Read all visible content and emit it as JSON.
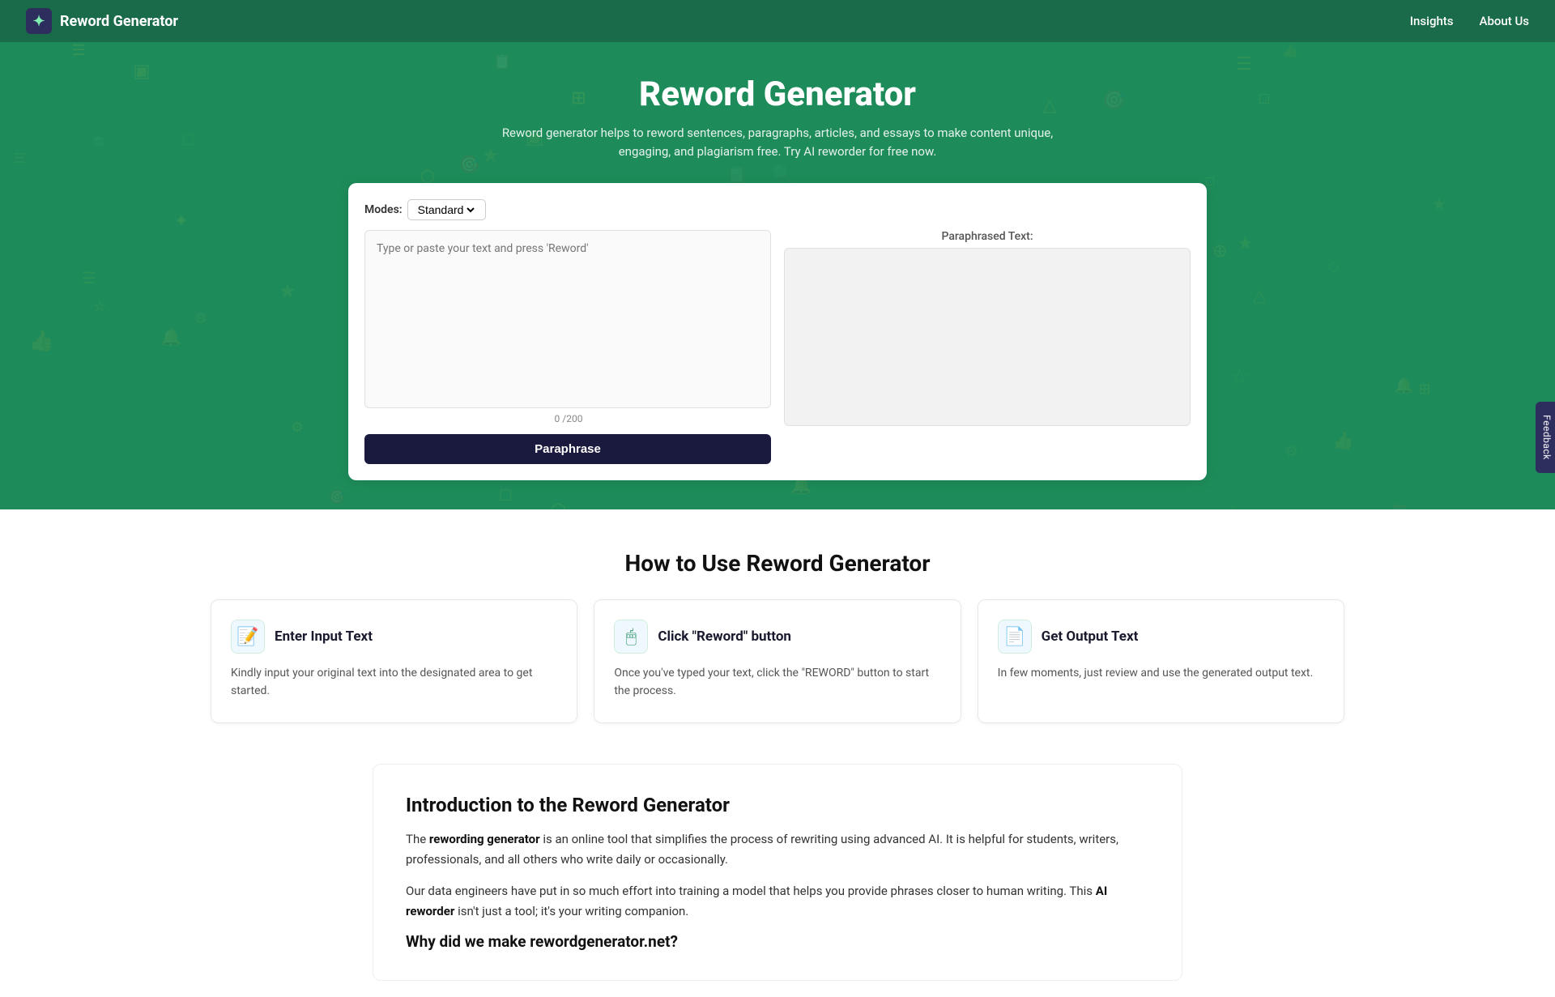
{
  "nav": {
    "brand": "Reword Generator",
    "logo_icon": "✦",
    "links": [
      {
        "label": "Insights",
        "href": "#"
      },
      {
        "label": "About Us",
        "href": "#"
      }
    ]
  },
  "hero": {
    "title": "Reword Generator",
    "subtitle": "Reword generator helps to reword sentences, paragraphs, articles, and essays to make content unique, engaging, and plagiarism free. Try AI reworder for free now.",
    "bg_icons": [
      "☰",
      "⏳",
      "🔍",
      "□",
      "◎",
      "☆",
      "⏳",
      "🔍",
      "⚙",
      "★",
      "⏳",
      "◎",
      "☰",
      "⏳",
      "▣",
      "□",
      "◎",
      "☆",
      "⏳",
      "🔍",
      "⚙",
      "★",
      "⏳",
      "◎",
      "☰",
      "👍",
      "📋",
      "🐦",
      "⏳",
      "☆",
      "★",
      "🔔",
      "🎯",
      "▣",
      "🔍",
      "◎",
      "☰",
      "⏳",
      "☆",
      "⚙",
      "★",
      "▣",
      "□",
      "◎",
      "👍",
      "📋",
      "🐦",
      "⏳",
      "☆",
      "★",
      "🔔",
      "🎯",
      "☰",
      "⏳",
      "▣",
      "🔍",
      "◎",
      "□",
      "◎",
      "☆",
      "⏳",
      "🔍",
      "⚙",
      "★",
      "⏳",
      "◎",
      "☰",
      "⏳",
      "▣",
      "□",
      "◎",
      "☆",
      "⏳",
      "🔍",
      "⚙",
      "★",
      "⏳",
      "◎",
      "☰"
    ]
  },
  "tool": {
    "modes_label": "Modes:",
    "mode_default": "Standard",
    "input_placeholder": "Type or paste your text and press 'Reword'",
    "paraphrased_label": "Paraphrased Text:",
    "char_count": "0",
    "char_max": "200",
    "paraphrase_btn": "Paraphrase"
  },
  "how_to": {
    "title": "How to Use Reword Generator",
    "steps": [
      {
        "icon": "📝",
        "title": "Enter Input Text",
        "desc": "Kindly input your original text into the designated area to get started."
      },
      {
        "icon": "🖱",
        "title": "Click \"Reword\" button",
        "desc": "Once you've typed your text, click the \"REWORD\" button to start the process."
      },
      {
        "icon": "📄",
        "title": "Get Output Text",
        "desc": "In few moments, just review and use the generated output text."
      }
    ]
  },
  "intro": {
    "title": "Introduction to the Reword Generator",
    "paragraphs": [
      {
        "text": "The ",
        "bold1": "rewording generator",
        "mid": " is an online tool that simplifies the process of rewriting using advanced AI. It is helpful for students, writers, professionals, and all others who write daily or occasionally.",
        "bold2": null,
        "end": null
      },
      {
        "text": "Our data engineers have put in so much effort into training a model that helps you provide phrases closer to human writing. This ",
        "bold1": "AI reworder",
        "mid": " isn't just a tool; it's your writing companion.",
        "bold2": null,
        "end": null
      }
    ],
    "sub_heading": "Why did we make rewordgenerator.net?"
  },
  "feedback": {
    "label": "Feedback"
  }
}
